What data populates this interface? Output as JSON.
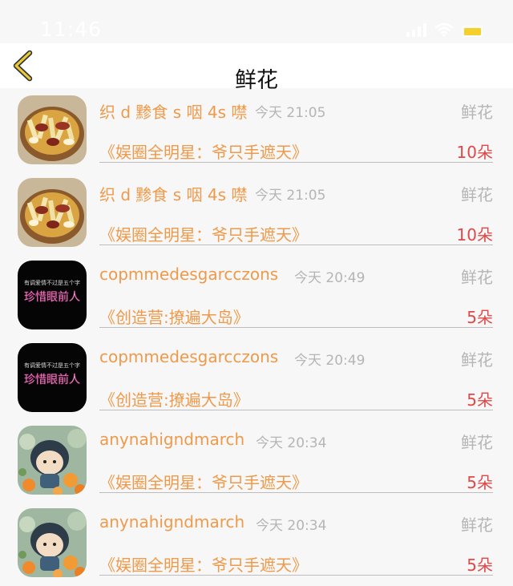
{
  "status_bar": {
    "time": "11:46"
  },
  "nav": {
    "title": "鲜花"
  },
  "colors": {
    "accent": "#ef9a4a",
    "count": "#e04848",
    "meta": "#b5b5b5",
    "back_arrow": "#e8c93a"
  },
  "rows": [
    {
      "name": "织 d 黪食 s 咽 4s 噤",
      "time": "今天 21:05",
      "type": "鲜花",
      "show": "《娱圈全明星：爷只手遮天》",
      "count": "10朵",
      "avatar_icon": "food-avatar-icon"
    },
    {
      "name": "织 d 黪食 s 咽 4s 噤",
      "time": "今天 21:05",
      "type": "鲜花",
      "show": "《娱圈全明星：爷只手遮天》",
      "count": "10朵",
      "avatar_icon": "food-avatar-icon"
    },
    {
      "name": "copmmedesgarcczons",
      "time": "今天 20:49",
      "type": "鲜花",
      "show": "《创造营:撩遍大岛》",
      "count": "5朵",
      "avatar_icon": "text-avatar-icon",
      "avatar_text_top": "有调爱情不过是五个字",
      "avatar_text_main": "珍惜眼前人"
    },
    {
      "name": "copmmedesgarcczons",
      "time": "今天 20:49",
      "type": "鲜花",
      "show": "《创造营:撩遍大岛》",
      "count": "5朵",
      "avatar_icon": "text-avatar-icon",
      "avatar_text_top": "有调爱情不过是五个字",
      "avatar_text_main": "珍惜眼前人"
    },
    {
      "name": "anynahigndmarch",
      "time": "今天 20:34",
      "type": "鲜花",
      "show": "《娱圈全明星：爷只手遮天》",
      "count": "5朵",
      "avatar_icon": "doll-avatar-icon"
    },
    {
      "name": "anynahigndmarch",
      "time": "今天 20:34",
      "type": "鲜花",
      "show": "《娱圈全明星：爷只手遮天》",
      "count": "5朵",
      "avatar_icon": "doll-avatar-icon"
    }
  ]
}
